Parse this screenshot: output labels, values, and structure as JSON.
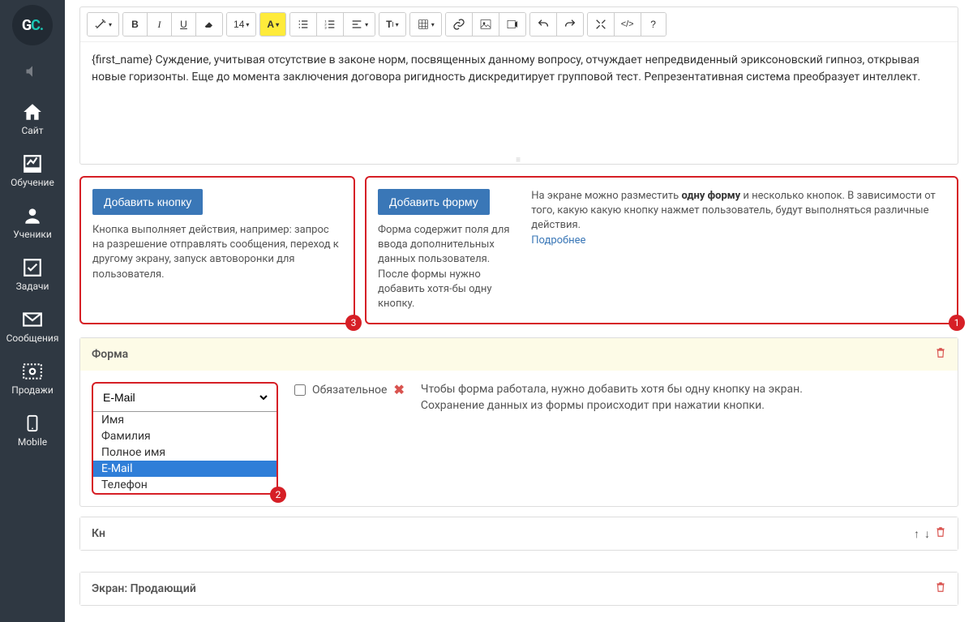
{
  "sidebar": {
    "logo": {
      "g": "G",
      "c": "C",
      "dot": "."
    },
    "items": [
      {
        "name": "site",
        "label": "Сайт"
      },
      {
        "name": "learning",
        "label": "Обучение"
      },
      {
        "name": "users",
        "label": "Ученики"
      },
      {
        "name": "tasks",
        "label": "Задачи"
      },
      {
        "name": "messages",
        "label": "Сообщения"
      },
      {
        "name": "sales",
        "label": "Продажи"
      },
      {
        "name": "mobile",
        "label": "Mobile"
      }
    ]
  },
  "toolbar": {
    "fontsize": "14",
    "bold": "B",
    "italic": "I",
    "underline": "U",
    "highlight": "A",
    "fontSizeGlyph": "T",
    "codeGlyph": "</>",
    "helpGlyph": "?"
  },
  "editor": {
    "text": "{first_name} Суждение, учитывая отсутствие в законе норм, посвященных данному вопросу, отчуждает непредвиденный эриксоновский гипноз, открывая новые горизонты. Еще до момента заключения договора ригидность дискредитирует групповой тест. Репрезентативная система преобразует интеллект."
  },
  "boxes": {
    "add_button": {
      "btn": "Добавить кнопку",
      "desc": "Кнопка выполняет действия, например: запрос на разрешение отправлять сообщения, переход к другому экрану, запуск автоворонки для пользователя.",
      "badge": "3"
    },
    "add_form": {
      "btn": "Добавить форму",
      "desc": "Форма содержит поля для ввода дополнительных данных пользователя. После формы нужно добавить хотя-бы одну кнопку.",
      "badge": "1"
    },
    "side_note": {
      "pre": "На экране можно разместить ",
      "bold": "одну форму",
      "post": " и несколько кнопок. В зависимости от того, какую какую кнопку нажмет пользователь, будут выполняться различные действия.",
      "link": "Подробнее"
    }
  },
  "form_panel": {
    "title": "Форма",
    "select_value": "E-Mail",
    "options": [
      "Имя",
      "Фамилия",
      "Полное имя",
      "E-Mail",
      "Телефон"
    ],
    "required_label": "Обязательное",
    "required_checked": false,
    "note": "Чтобы форма работала, нужно добавить хотя бы одну кнопку на экран. Сохранение данных из формы происходит при нажатии кнопки.",
    "badge": "2"
  },
  "buttons_panel": {
    "title_visible": "Кн"
  },
  "screen_panel": {
    "title": "Экран: Продающий"
  },
  "colors": {
    "accent": "#3a77b7",
    "danger": "#d61f26",
    "highlight": "#d9534f"
  }
}
